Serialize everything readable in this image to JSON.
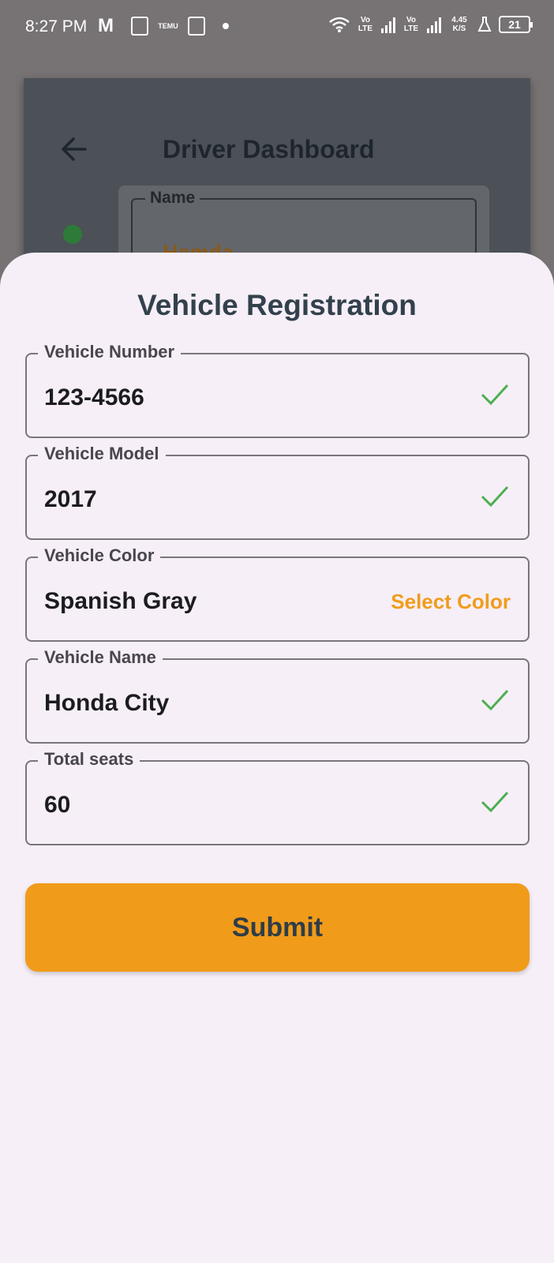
{
  "status_bar": {
    "time": "8:27 PM",
    "temu": "TEMU",
    "volte_1": "Vo LTE",
    "volte_2": "Vo LTE",
    "speed": "4.45 K/S",
    "battery": "21"
  },
  "background_dashboard": {
    "title": "Driver Dashboard",
    "name_label": "Name",
    "name_value": "Hamda"
  },
  "sheet": {
    "title": "Vehicle Registration",
    "fields": [
      {
        "label": "Vehicle Number",
        "value": "123-4566",
        "valid": true
      },
      {
        "label": "Vehicle Model",
        "value": "2017",
        "valid": true
      },
      {
        "label": "Vehicle Color",
        "value": "Spanish Gray",
        "action": "Select Color"
      },
      {
        "label": "Vehicle Name",
        "value": "Honda City",
        "valid": true
      },
      {
        "label": "Total seats",
        "value": "60",
        "valid": true
      }
    ],
    "submit_label": "Submit"
  },
  "colors": {
    "accent": "#f19b1a",
    "check": "#4caf50",
    "sheet_bg": "#f6eff7",
    "title": "#33414d"
  }
}
